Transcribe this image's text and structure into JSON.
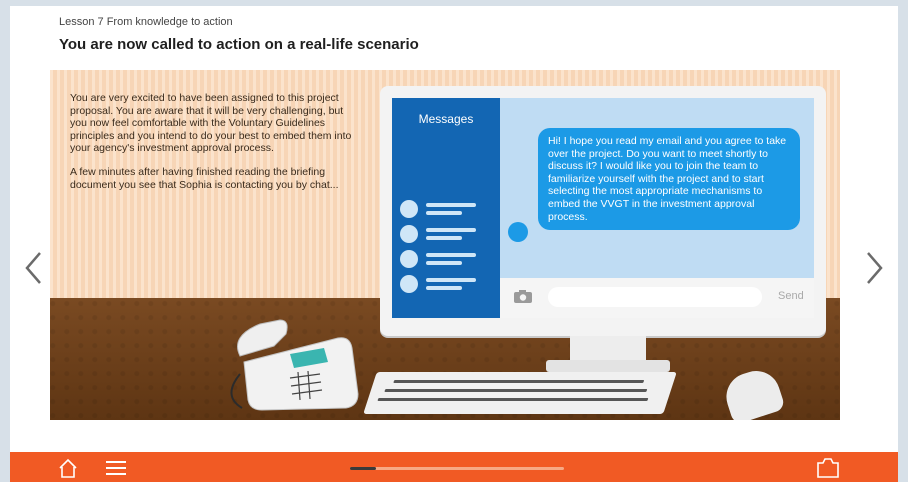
{
  "lesson": {
    "label": "Lesson 7  From knowledge to action"
  },
  "page": {
    "title": "You are now called to action on a real-life scenario"
  },
  "narrative": {
    "paragraph1": "You are very excited to have been assigned to this project proposal. You are aware that it will be very challenging, but you now feel comfortable with the Voluntary Guidelines principles and you intend to do your best to embed them into your agency's investment approval process.",
    "paragraph2": "A few minutes after having finished reading the briefing document you see that Sophia is contacting you by chat..."
  },
  "chat": {
    "panel_title": "Messages",
    "message": "Hi! I hope you read my email and you agree to take over the project. Do you want to meet shortly to discuss it? I would like you to join the team to familiarize yourself with the project and to start selecting the most appropriate mechanisms to embed the VVGT in the investment approval process.",
    "input_value": "",
    "send_label": "Send"
  },
  "footer": {
    "progress": 0.12
  },
  "colors": {
    "accent": "#f15a24",
    "messages_panel": "#1366b3",
    "bubble": "#1c9ae6"
  },
  "icons": [
    "chevron-left-icon",
    "chevron-right-icon",
    "home-icon",
    "menu-icon",
    "glossary-icon",
    "camera-icon"
  ]
}
